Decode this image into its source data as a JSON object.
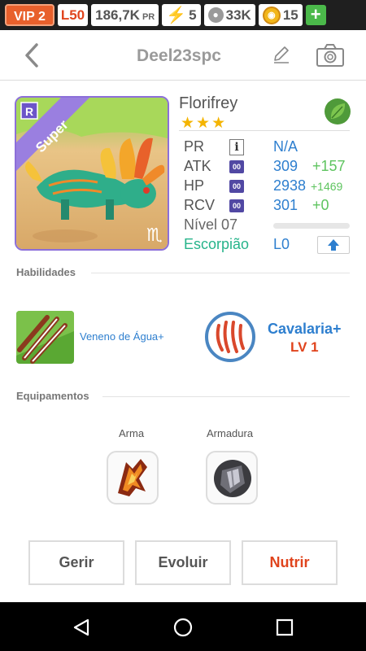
{
  "status_bar": {
    "vip": "VIP 2",
    "level": "L50",
    "power_value": "186,7K",
    "power_unit": "PR",
    "energy": "5",
    "food": "33K",
    "gold": "15",
    "add_label": "+"
  },
  "header": {
    "title": "Deel23spc"
  },
  "monster": {
    "rarity_badge": "R",
    "tier_ribbon": "Super",
    "name": "Florifrey",
    "stars": "★★★",
    "element_icon": "leaf-icon",
    "stats": [
      {
        "label": "PR",
        "value": "N/A",
        "bonus": ""
      },
      {
        "label": "ATK",
        "badge": "00",
        "value": "309",
        "bonus": "+157"
      },
      {
        "label": "HP",
        "badge": "00",
        "value": "2938",
        "bonus": "+1469"
      },
      {
        "label": "RCV",
        "badge": "00",
        "value": "301",
        "bonus": "+0"
      }
    ],
    "level_label": "Nível 07",
    "level_progress": 0,
    "zodiac_label": "Escorpião",
    "zodiac_level": "L0"
  },
  "sections": {
    "skills": "Habilidades",
    "equipment": "Equipamentos"
  },
  "skills": [
    {
      "name": "Veneno de Água+",
      "icon": "venom-claw-icon"
    },
    {
      "name": "Cavalaria+",
      "level": "LV 1",
      "icon": "claw-scratch-icon"
    }
  ],
  "equipment": [
    {
      "label": "Arma",
      "icon": "weapon-icon"
    },
    {
      "label": "Armadura",
      "icon": "armor-icon"
    }
  ],
  "buttons": {
    "manage": "Gerir",
    "evolve": "Evoluir",
    "feed": "Nutrir"
  },
  "colors": {
    "accent_blue": "#2e7fcf",
    "accent_red": "#e0441d",
    "bonus_green": "#5ec45f",
    "zodiac_teal": "#27b48b"
  }
}
